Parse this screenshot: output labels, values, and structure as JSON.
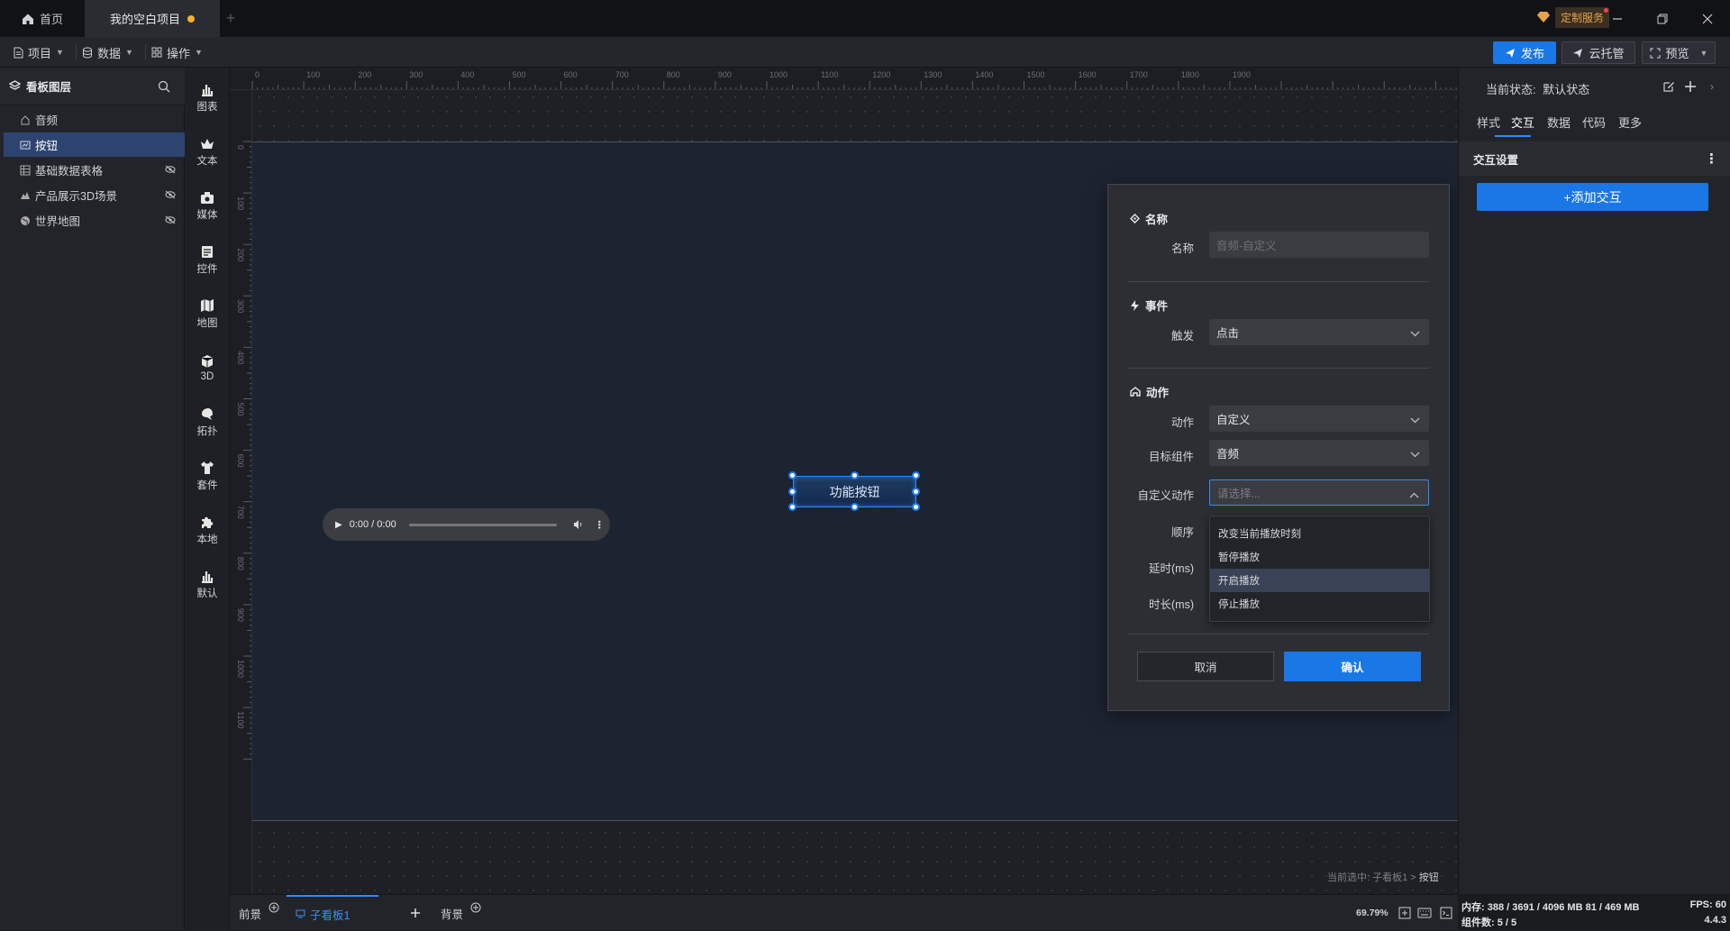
{
  "titlebar": {
    "home_tab": "首页",
    "project_tab": "我的空白项目",
    "custom_service": "定制服务"
  },
  "toolbar": {
    "menu_project": "项目",
    "menu_data": "数据",
    "menu_operation": "操作",
    "publish": "发布",
    "cloud_hosting": "云托管",
    "preview": "预览"
  },
  "layers": {
    "title": "看板图层",
    "items": [
      {
        "label": "音频"
      },
      {
        "label": "按钮"
      },
      {
        "label": "基础数据表格"
      },
      {
        "label": "产品展示3D场景"
      },
      {
        "label": "世界地图"
      }
    ]
  },
  "components": [
    "图表",
    "文本",
    "媒体",
    "控件",
    "地图",
    "3D",
    "拓扑",
    "套件",
    "本地",
    "默认"
  ],
  "ruler": {
    "top_ticks": [
      "0",
      "100",
      "200",
      "300",
      "400",
      "500",
      "600",
      "700",
      "800",
      "900",
      "1000",
      "1100",
      "1200",
      "1300",
      "1400",
      "1500",
      "1600",
      "1700",
      "1800",
      "1900"
    ],
    "left_ticks": [
      "0",
      "100",
      "200",
      "300",
      "400",
      "500",
      "600",
      "700",
      "800",
      "900",
      "1000",
      "1100"
    ]
  },
  "canvas": {
    "audio_time": "0:00 / 0:00",
    "function_button": "功能按钮",
    "selection_path_prefix": "当前选中: 子看板1 > ",
    "selection_path_item": "按钮"
  },
  "dialog": {
    "name_section": "名称",
    "name_label": "名称",
    "name_placeholder": "音频-自定义",
    "event_section": "事件",
    "trigger_label": "触发",
    "trigger_value": "点击",
    "action_section": "动作",
    "action_label": "动作",
    "action_value": "自定义",
    "target_label": "目标组件",
    "target_value": "音频",
    "custom_action_label": "自定义动作",
    "custom_action_placeholder": "请选择...",
    "order_label": "顺序",
    "delay_label": "延时(ms)",
    "duration_label": "时长(ms)",
    "dropdown_options": [
      "改变当前播放时刻",
      "暂停播放",
      "开启播放",
      "停止播放"
    ],
    "highlighted_option": "开启播放",
    "cancel": "取消",
    "confirm": "确认"
  },
  "right_panel": {
    "state_label": "当前状态:",
    "state_value": "默认状态",
    "tabs": [
      "样式",
      "交互",
      "数据",
      "代码",
      "更多"
    ],
    "active_tab": "交互",
    "section_title": "交互设置",
    "add_button": "+添加交互"
  },
  "bottom": {
    "tab_front": "前景",
    "tab_sub": "子看板1",
    "tab_back": "背景",
    "zoom": "69.79%"
  },
  "stats": {
    "memory_label": "内存:",
    "memory_value": "388 / 3691 / 4096 MB  81 / 469 MB",
    "fps_label": "FPS:",
    "fps_value": "60",
    "components_label": "组件数:",
    "components_value": "5 / 5",
    "version": "4.4.3"
  },
  "colors": {
    "accent": "#1a77e6",
    "selection": "#2e4470",
    "unsaved_dot": "#f5b12e"
  }
}
